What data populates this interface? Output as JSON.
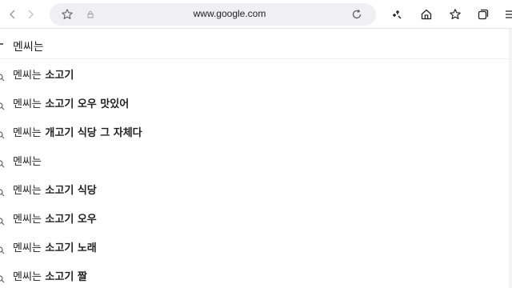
{
  "browser": {
    "url": "www.google.com",
    "icons": {
      "back": "arrow-left-icon",
      "forward": "arrow-right-icon",
      "bookmark": "star-outline-icon",
      "lock": "lock-icon",
      "reload": "reload-icon",
      "extension": "extensions-icon",
      "home": "home-icon",
      "favorites": "favorites-star-icon",
      "tabs": "collections-icon",
      "menu": "menu-icon"
    }
  },
  "search": {
    "query": "멘씨는"
  },
  "suggestions": [
    {
      "prefix": "멘씨는",
      "suffix": " 소고기"
    },
    {
      "prefix": "멘씨는",
      "suffix": " 소고기 오우 맛있어"
    },
    {
      "prefix": "멘씨는",
      "suffix": " 개고기 식당 그 자체다"
    },
    {
      "prefix": "멘씨는",
      "suffix": ""
    },
    {
      "prefix": "멘씨는",
      "suffix": " 소고기 식당"
    },
    {
      "prefix": "멘씨는",
      "suffix": " 소고기 오우"
    },
    {
      "prefix": "멘씨는",
      "suffix": " 소고기 노래"
    },
    {
      "prefix": "멘씨는",
      "suffix": " 소고기 짤"
    }
  ]
}
